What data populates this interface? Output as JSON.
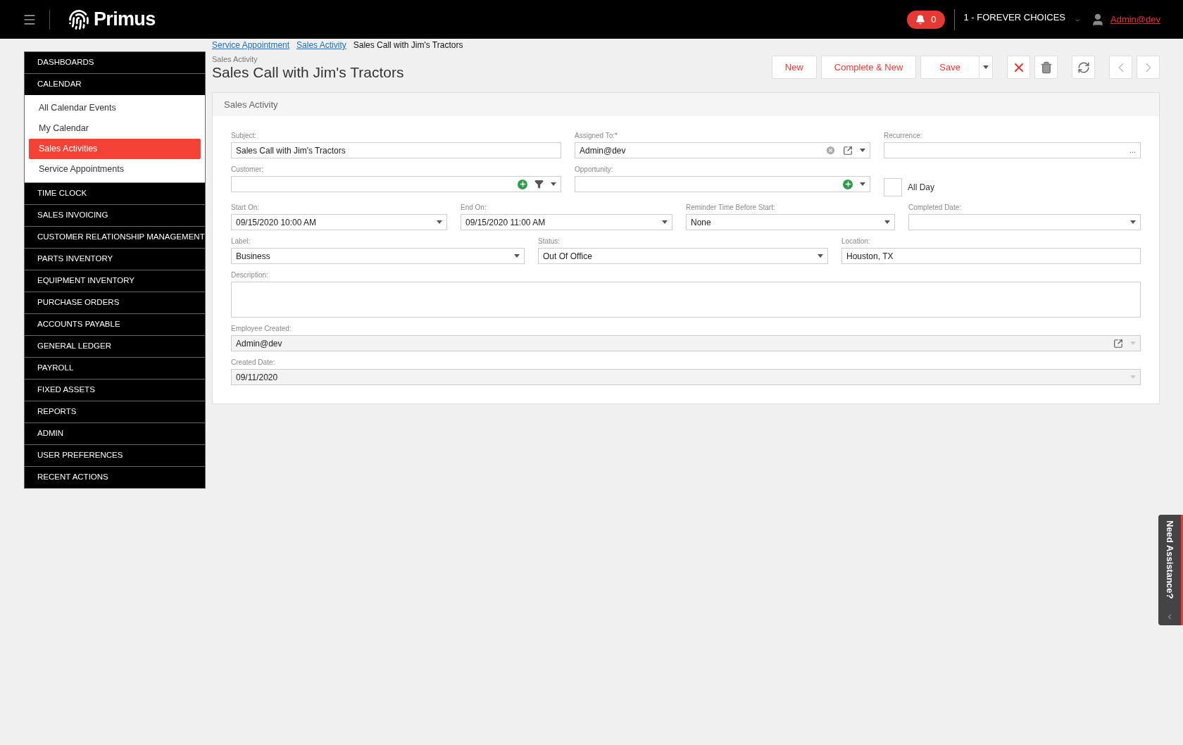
{
  "header": {
    "brand": "Primus",
    "notifications": "0",
    "company": "1 - FOREVER CHOICES",
    "user": "Admin@dev"
  },
  "sidebar": [
    {
      "label": "DASHBOARDS"
    },
    {
      "label": "CALENDAR",
      "children": [
        {
          "label": "All Calendar Events",
          "selected": false
        },
        {
          "label": "My Calendar",
          "selected": false
        },
        {
          "label": "Sales Activities",
          "selected": true
        },
        {
          "label": "Service Appointments",
          "selected": false
        }
      ]
    },
    {
      "label": "TIME CLOCK"
    },
    {
      "label": "SALES INVOICING"
    },
    {
      "label": "CUSTOMER RELATIONSHIP MANAGEMENT"
    },
    {
      "label": "PARTS INVENTORY"
    },
    {
      "label": "EQUIPMENT INVENTORY"
    },
    {
      "label": "PURCHASE ORDERS"
    },
    {
      "label": "ACCOUNTS PAYABLE"
    },
    {
      "label": "GENERAL LEDGER"
    },
    {
      "label": "PAYROLL"
    },
    {
      "label": "FIXED ASSETS"
    },
    {
      "label": "REPORTS"
    },
    {
      "label": "ADMIN"
    },
    {
      "label": "USER PREFERENCES"
    },
    {
      "label": "RECENT ACTIONS"
    }
  ],
  "breadcrumbs": [
    {
      "label": "Service Appointment",
      "link": true
    },
    {
      "label": "Sales Activity",
      "link": true
    },
    {
      "label": "Sales Call with Jim's Tractors",
      "link": false
    }
  ],
  "page": {
    "subtitle": "Sales Activity",
    "title": "Sales Call with Jim's Tractors"
  },
  "toolbar": [
    {
      "kind": "text",
      "label": "New"
    },
    {
      "kind": "text",
      "label": "Complete & New"
    },
    {
      "kind": "split",
      "label": "Save"
    },
    {
      "kind": "cancel",
      "disabled": false
    },
    {
      "kind": "delete",
      "disabled": false
    },
    {
      "kind": "refresh",
      "disabled": false
    },
    {
      "kind": "previous",
      "disabled": true
    },
    {
      "kind": "next",
      "disabled": true
    }
  ],
  "form": {
    "title": "Sales Activity",
    "rows": [
      {
        "kind": "triple",
        "fields": [
          {
            "kind": "text",
            "label": "Subject:",
            "value": "Sales Call with Jim's Tractors"
          },
          {
            "kind": "lookup",
            "label": "Assigned To:*",
            "value": "Admin@dev",
            "actions": [
              {
                "kind": "clear"
              },
              {
                "kind": "open"
              },
              {
                "kind": "caret"
              }
            ]
          },
          {
            "kind": "text",
            "label": "Recurrence:",
            "suffix": "..."
          }
        ]
      },
      {
        "kind": "triple",
        "fields": [
          {
            "kind": "lookup",
            "label": "Customer:",
            "actions": [
              {
                "kind": "add"
              },
              {
                "kind": "filter"
              },
              {
                "kind": "caret"
              }
            ]
          },
          {
            "kind": "lookup",
            "label": "Opportunity:",
            "actions": [
              {
                "kind": "add"
              },
              {
                "kind": "caret"
              }
            ]
          },
          {
            "kind": "checkbox",
            "label": "All Day",
            "checked": false
          }
        ]
      },
      {
        "kind": "quad",
        "fields": [
          {
            "kind": "dropdown",
            "label": "Start On:",
            "value": "09/15/2020 10:00 AM"
          },
          {
            "kind": "dropdown",
            "label": "End On:",
            "value": "09/15/2020 11:00 AM"
          },
          {
            "kind": "dropdown",
            "label": "Reminder Time Before Start:",
            "value": "None"
          },
          {
            "kind": "dropdown",
            "label": "Completed Date:"
          }
        ]
      },
      {
        "kind": "mixed",
        "fields": [
          {
            "kind": "dropdown",
            "label": "Label:",
            "value": "Business"
          },
          {
            "kind": "dropdown",
            "label": "Status:",
            "value": "Out Of Office"
          },
          {
            "kind": "text",
            "label": "Location:",
            "value": "Houston, TX"
          }
        ]
      },
      {
        "kind": "single",
        "fields": [
          {
            "kind": "textarea",
            "label": "Description:"
          }
        ]
      },
      {
        "kind": "single",
        "fields": [
          {
            "kind": "lookup",
            "label": "Employee Created:",
            "value": "Admin@dev",
            "disabled": true,
            "actions": [
              {
                "kind": "open"
              },
              {
                "kind": "caret"
              }
            ]
          }
        ]
      },
      {
        "kind": "single",
        "fields": [
          {
            "kind": "dropdown",
            "label": "Created Date:",
            "value": "09/11/2020",
            "disabled": true
          }
        ]
      }
    ]
  },
  "assistance": {
    "label": "Need Assistance?"
  }
}
